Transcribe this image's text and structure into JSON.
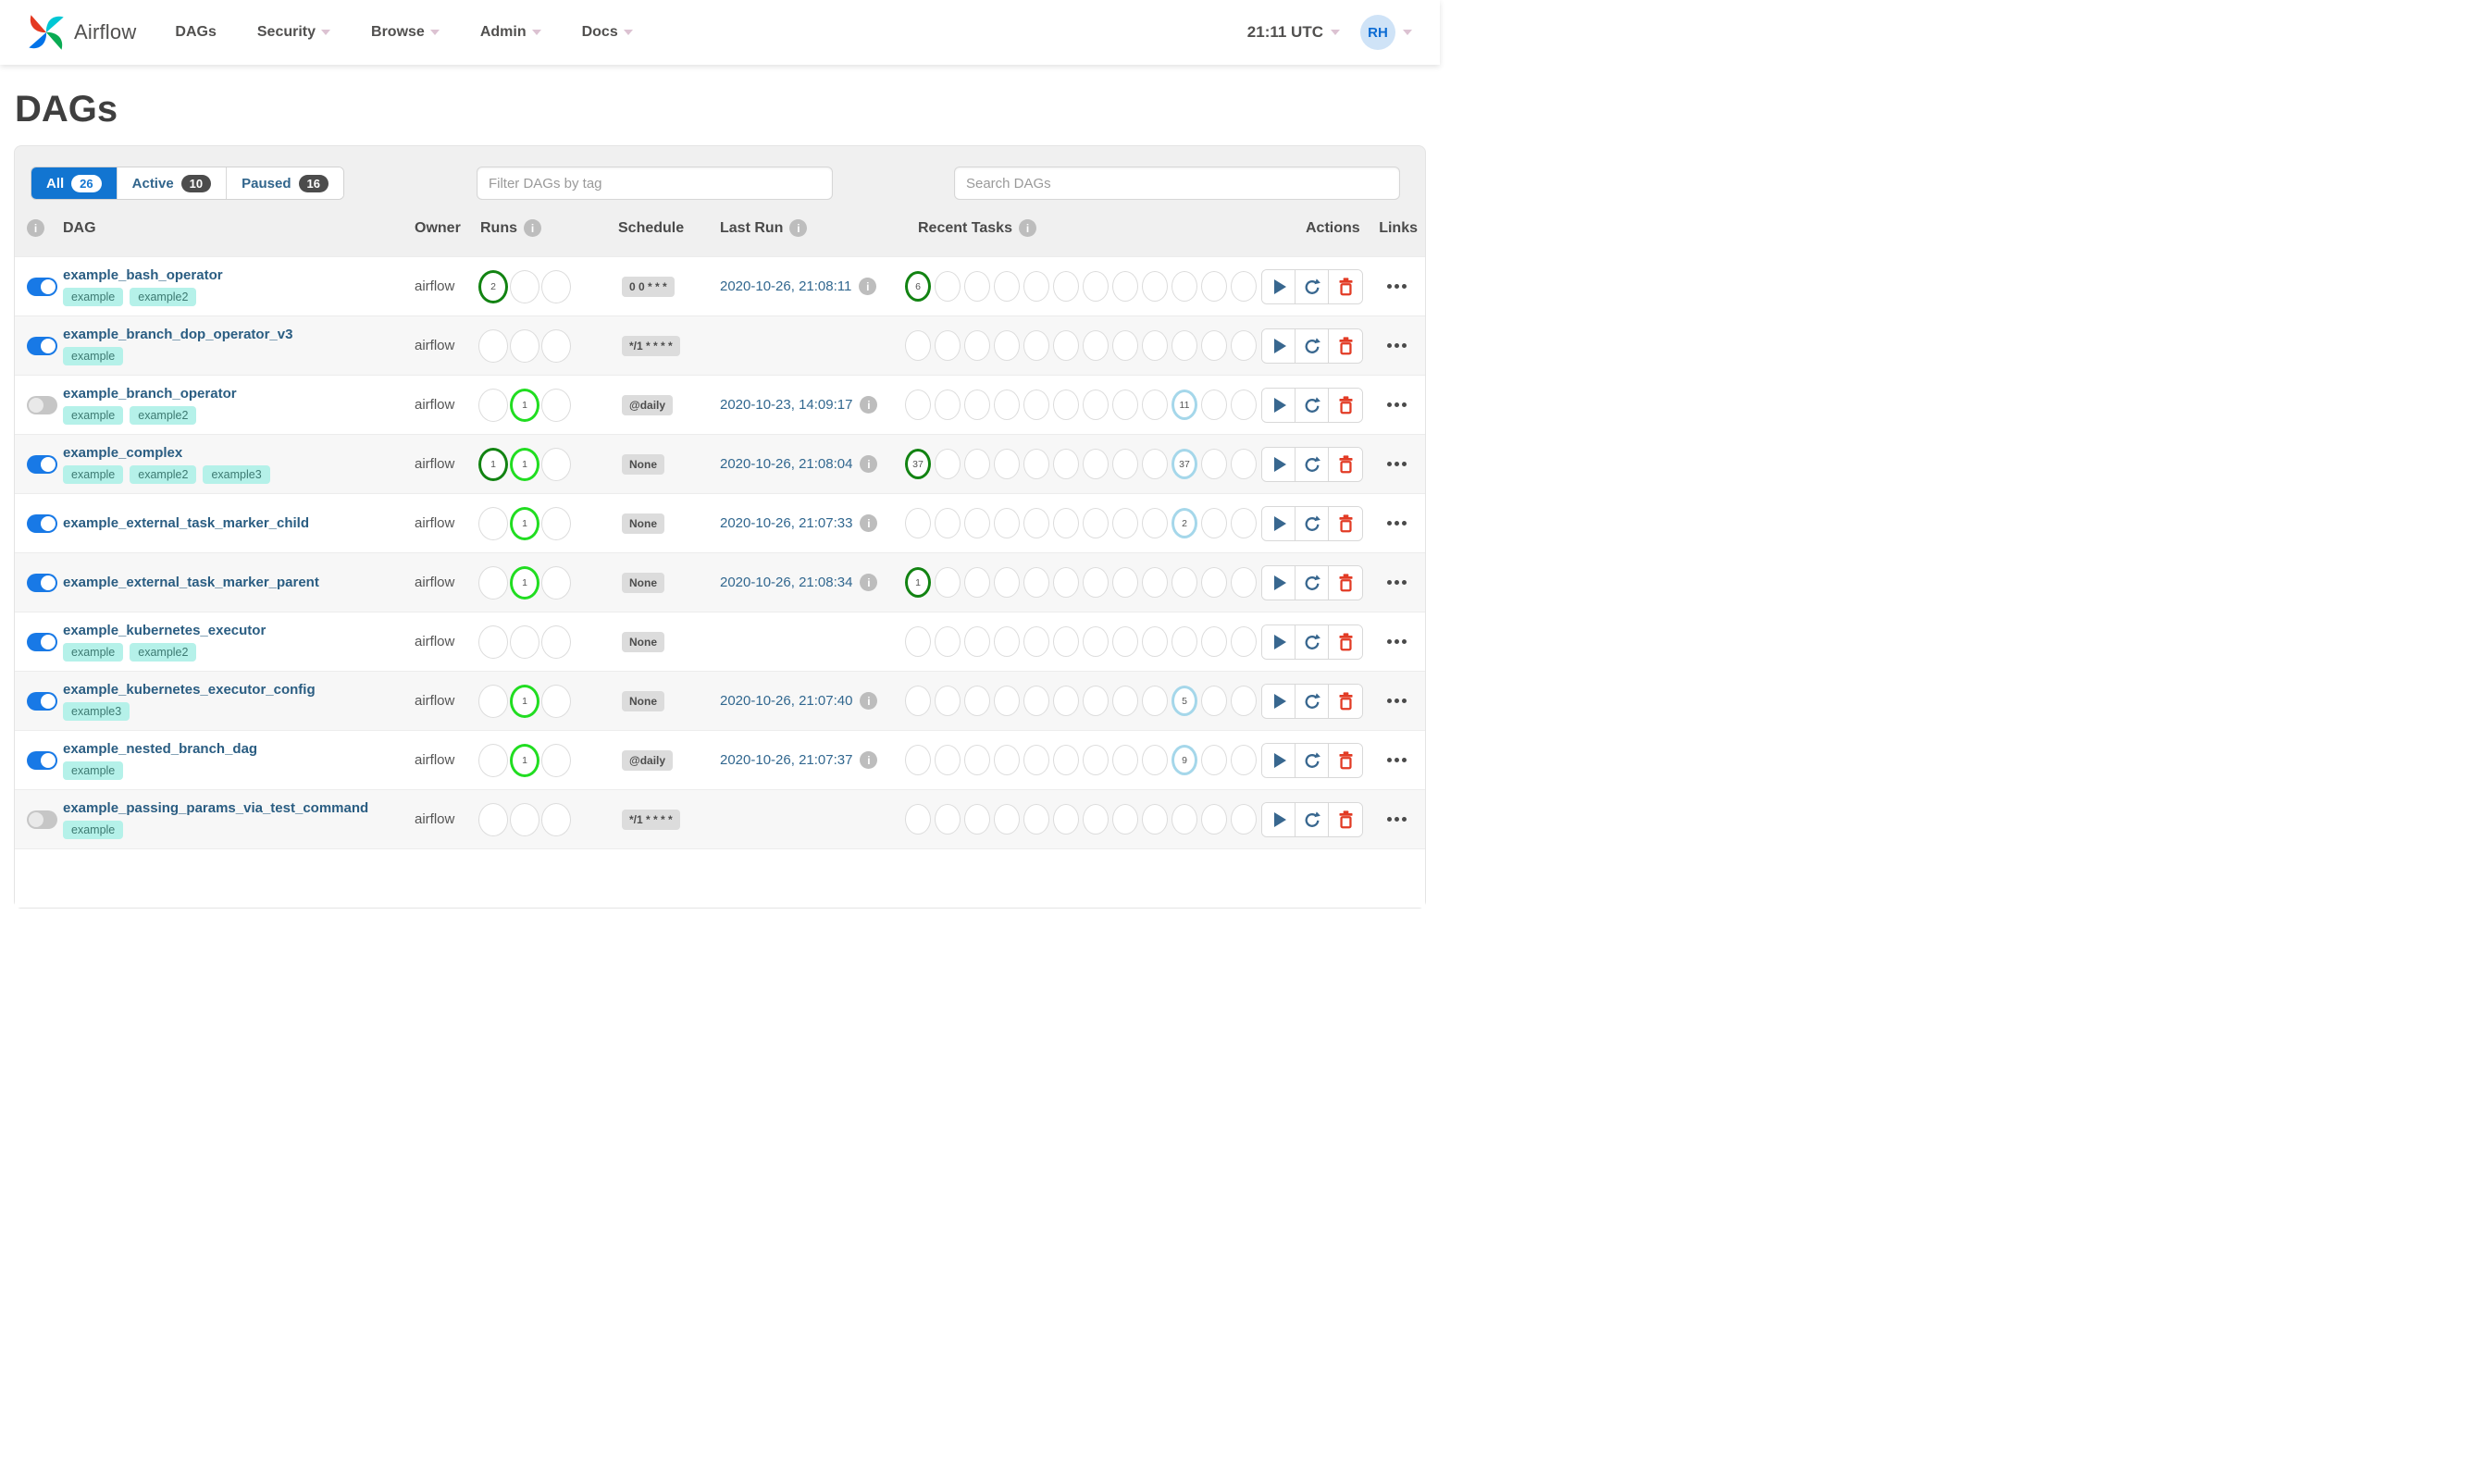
{
  "nav": {
    "brand": "Airflow",
    "items": [
      {
        "label": "DAGs",
        "caret": false
      },
      {
        "label": "Security",
        "caret": true
      },
      {
        "label": "Browse",
        "caret": true
      },
      {
        "label": "Admin",
        "caret": true
      },
      {
        "label": "Docs",
        "caret": true
      }
    ],
    "clock": "21:11 UTC",
    "avatar": "RH"
  },
  "page": {
    "title": "DAGs"
  },
  "tabs": [
    {
      "label": "All",
      "count": "26",
      "active": true
    },
    {
      "label": "Active",
      "count": "10",
      "active": false
    },
    {
      "label": "Paused",
      "count": "16",
      "active": false
    }
  ],
  "filters": {
    "tag_placeholder": "Filter DAGs by tag",
    "search_placeholder": "Search DAGs"
  },
  "table": {
    "headers": {
      "dag": "DAG",
      "owner": "Owner",
      "runs": "Runs",
      "schedule": "Schedule",
      "last_run": "Last Run",
      "recent_tasks": "Recent Tasks",
      "actions": "Actions",
      "links": "Links"
    },
    "runs_states": [
      "success",
      "running",
      "failed"
    ],
    "recent_slots": 12,
    "recent_state_positions": {
      "success": 0,
      "none": 9
    },
    "rows": [
      {
        "name": "example_bash_operator",
        "enabled": true,
        "tags": [
          "example",
          "example2"
        ],
        "owner": "airflow",
        "runs": {
          "success": 2
        },
        "schedule": "0 0 * * *",
        "last_run": "2020-10-26, 21:08:11",
        "recent": {
          "success": 6
        }
      },
      {
        "name": "example_branch_dop_operator_v3",
        "enabled": true,
        "tags": [
          "example"
        ],
        "owner": "airflow",
        "runs": {},
        "schedule": "*/1 * * * *",
        "last_run": "",
        "recent": {}
      },
      {
        "name": "example_branch_operator",
        "enabled": false,
        "tags": [
          "example",
          "example2"
        ],
        "owner": "airflow",
        "runs": {
          "running": 1
        },
        "schedule": "@daily",
        "last_run": "2020-10-23, 14:09:17",
        "recent": {
          "none": 11
        }
      },
      {
        "name": "example_complex",
        "enabled": true,
        "tags": [
          "example",
          "example2",
          "example3"
        ],
        "owner": "airflow",
        "runs": {
          "success": 1,
          "running": 1
        },
        "schedule": "None",
        "last_run": "2020-10-26, 21:08:04",
        "recent": {
          "success": 37,
          "none": 37
        }
      },
      {
        "name": "example_external_task_marker_child",
        "enabled": true,
        "tags": [],
        "owner": "airflow",
        "runs": {
          "running": 1
        },
        "schedule": "None",
        "last_run": "2020-10-26, 21:07:33",
        "recent": {
          "none": 2
        }
      },
      {
        "name": "example_external_task_marker_parent",
        "enabled": true,
        "tags": [],
        "owner": "airflow",
        "runs": {
          "running": 1
        },
        "schedule": "None",
        "last_run": "2020-10-26, 21:08:34",
        "recent": {
          "success": 1
        }
      },
      {
        "name": "example_kubernetes_executor",
        "enabled": true,
        "tags": [
          "example",
          "example2"
        ],
        "owner": "airflow",
        "runs": {},
        "schedule": "None",
        "last_run": "",
        "recent": {}
      },
      {
        "name": "example_kubernetes_executor_config",
        "enabled": true,
        "tags": [
          "example3"
        ],
        "owner": "airflow",
        "runs": {
          "running": 1
        },
        "schedule": "None",
        "last_run": "2020-10-26, 21:07:40",
        "recent": {
          "none": 5
        }
      },
      {
        "name": "example_nested_branch_dag",
        "enabled": true,
        "tags": [
          "example"
        ],
        "owner": "airflow",
        "runs": {
          "running": 1
        },
        "schedule": "@daily",
        "last_run": "2020-10-26, 21:07:37",
        "recent": {
          "none": 9
        }
      },
      {
        "name": "example_passing_params_via_test_command",
        "enabled": false,
        "tags": [
          "example"
        ],
        "owner": "airflow",
        "runs": {},
        "schedule": "*/1 * * * *",
        "last_run": "",
        "recent": {}
      }
    ]
  },
  "colors": {
    "accent_blue": "#1275d1",
    "toggle_on": "#1879e6",
    "state_success": "#128312",
    "state_running": "#21dd21",
    "state_none": "#a5d7ea",
    "state_failed": "#e43925",
    "tag_bg": "#b5f1e9",
    "delete_red": "#e23b25",
    "action_blue": "#38678f"
  }
}
